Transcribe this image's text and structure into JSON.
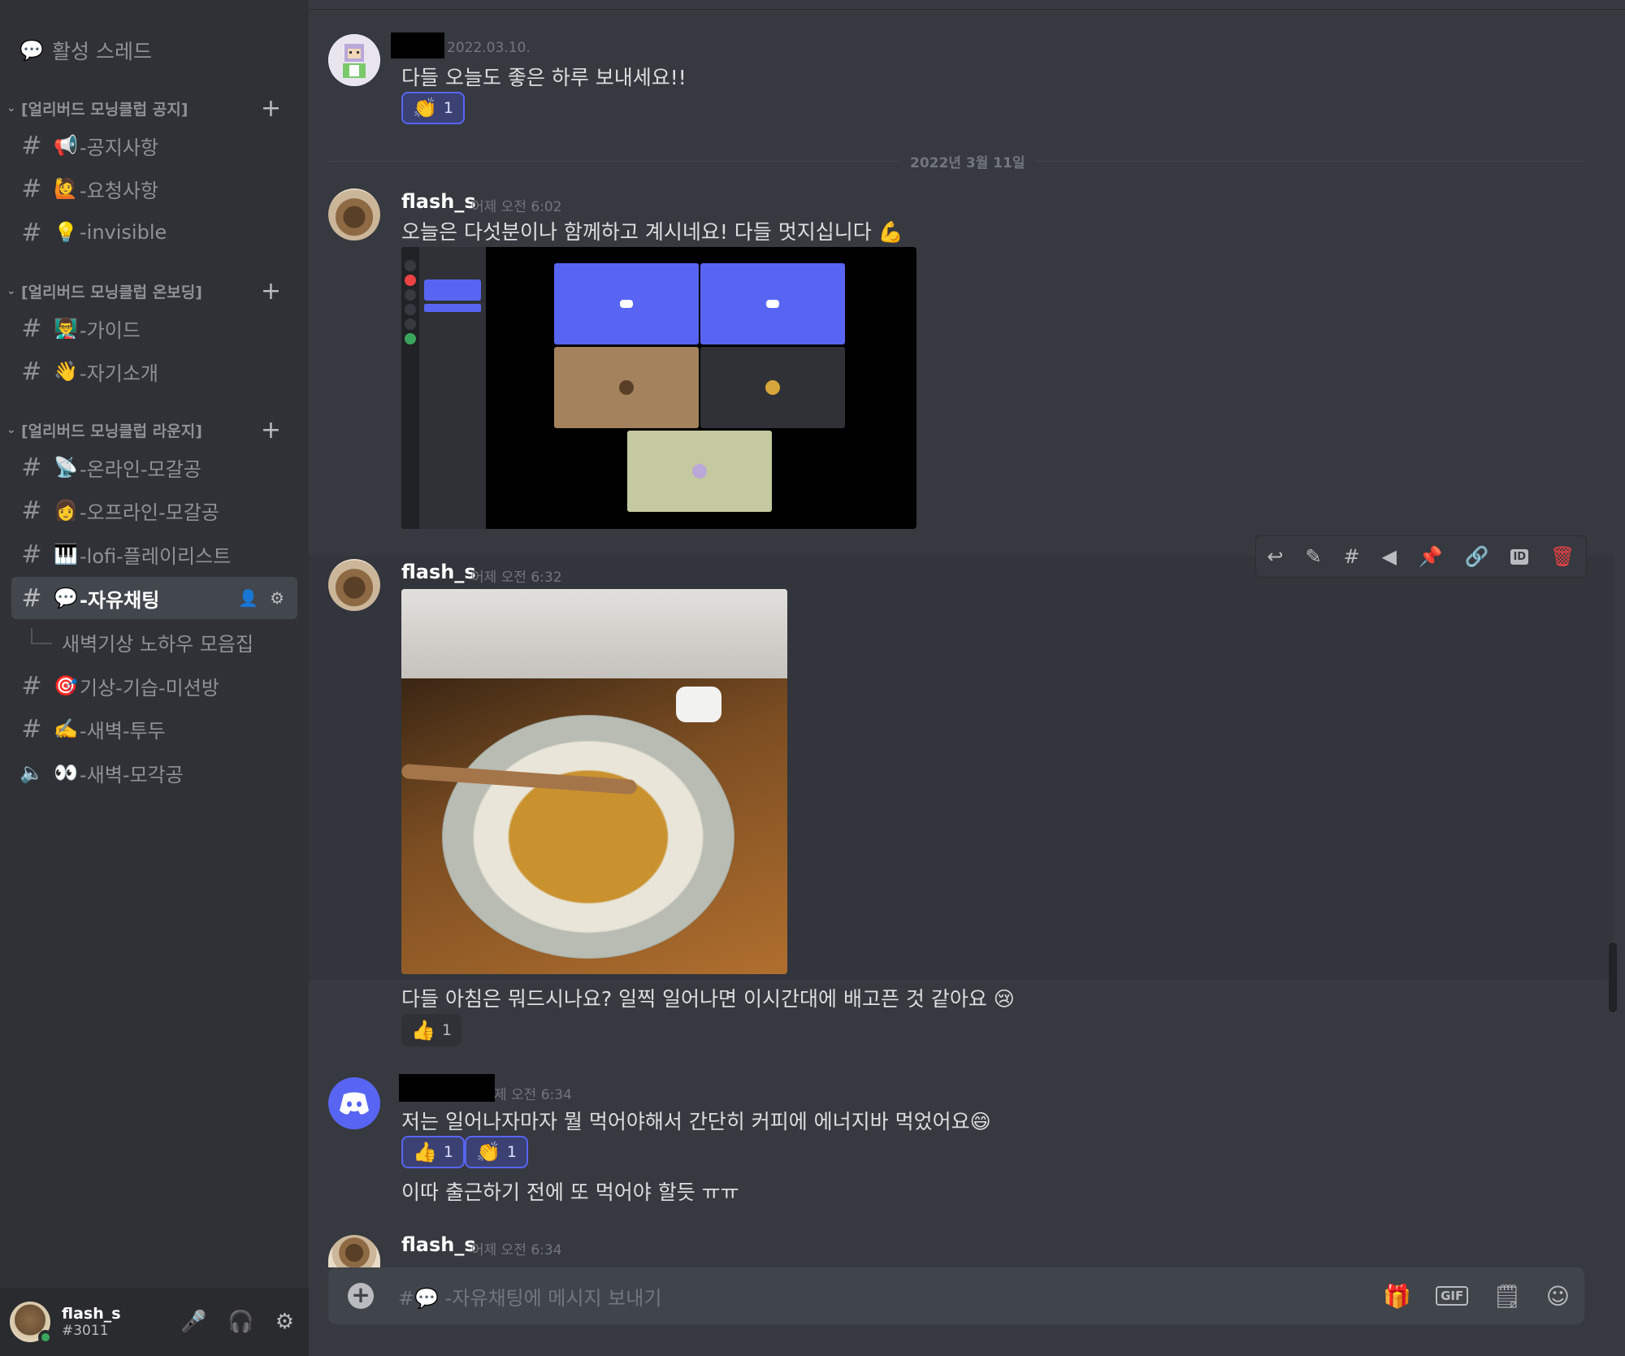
{
  "sidebar": {
    "active_threads": "활성 스레드",
    "categories": [
      {
        "name": "[얼리버드 모닝클럽 공지]",
        "channels": [
          {
            "emoji": "📢",
            "label": "-공지사항"
          },
          {
            "emoji": "🙋",
            "label": "-요청사항"
          },
          {
            "emoji": "💡",
            "label": "-invisible"
          }
        ]
      },
      {
        "name": "[얼리버드 모닝클럽 온보딩]",
        "channels": [
          {
            "emoji": "👨‍🏫",
            "label": "-가이드"
          },
          {
            "emoji": "👋",
            "label": "-자기소개"
          }
        ]
      },
      {
        "name": "[얼리버드 모닝클럽 라운지]",
        "channels": [
          {
            "emoji": "📡",
            "label": "-온라인-모갈공"
          },
          {
            "emoji": "👩",
            "label": "-오프라인-모갈공"
          },
          {
            "emoji": "🎹",
            "label": "-lofi-플레이리스트"
          },
          {
            "emoji": "💬",
            "label": "-자유채팅"
          },
          {
            "emoji": "🎯",
            "label": "기상-기습-미션방"
          },
          {
            "emoji": "✍️",
            "label": "-새벽-투두"
          },
          {
            "emoji": "👀",
            "label": "-새벽-모각공"
          }
        ]
      }
    ],
    "thread_label": "새벽기상 노하우 모음집"
  },
  "user_panel": {
    "name": "flash_s",
    "tag": "#3011"
  },
  "chat": {
    "date_divider": "2022년 3월 11일",
    "messages": [
      {
        "time": "2022.03.10.",
        "text": "다들 오늘도 좋은 하루 보내세요!!",
        "reactions": [
          {
            "emoji": "👏",
            "count": "1"
          }
        ]
      },
      {
        "author": "flash_s",
        "time": "어제 오전 6:02",
        "text": "오늘은 다섯분이나 함께하고 계시네요! 다들 멋지십니다 💪"
      },
      {
        "author": "flash_s",
        "time": "어제 오전 6:32",
        "text": "다들 아침은 뭐드시나요? 일찍 일어나면 이시간대에 배고픈 것 같아요 😢",
        "reactions": [
          {
            "emoji": "👍",
            "count": "1"
          }
        ]
      },
      {
        "time": "제 오전 6:34",
        "text": "저는 일어나자마자 뭘 먹어야해서 간단히 커피에 에너지바 먹었어요😄",
        "reactions": [
          {
            "emoji": "👍",
            "count": "1"
          },
          {
            "emoji": "👏",
            "count": "1"
          }
        ],
        "followup": "이따 출근하기 전에 또 먹어야 할듯 ㅠㅠ"
      },
      {
        "author": "flash_s",
        "time": "어제 오전 6:34"
      }
    ],
    "composer_placeholder": "#💬 -자유채팅에 메시지 보내기"
  }
}
